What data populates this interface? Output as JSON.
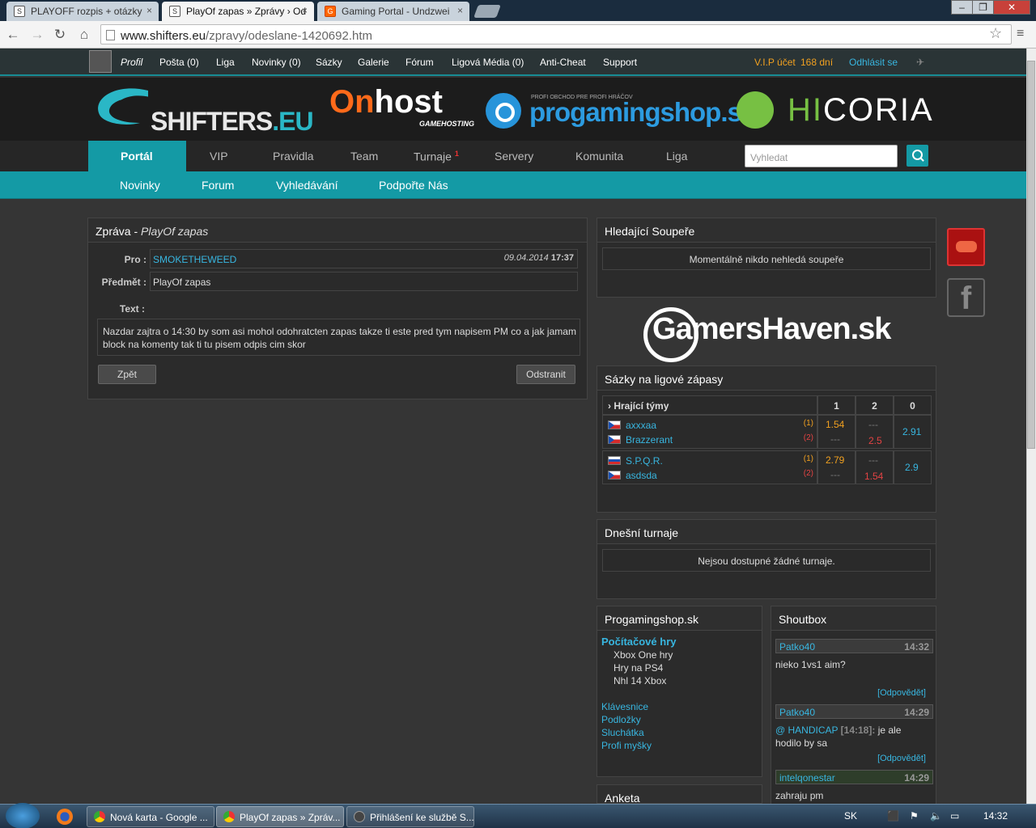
{
  "browser": {
    "tabs": [
      {
        "label": "PLAYOFF rozpis + otázky",
        "favicon": "S"
      },
      {
        "label": "PlayOf zapas » Zprávy › Od",
        "favicon": "S"
      },
      {
        "label": "Gaming Portal - Undzwei",
        "favicon": "G"
      }
    ],
    "url_host": "www.shifters.eu",
    "url_path": "/zpravy/odeslane-1420692.htm"
  },
  "topbar": {
    "profile": "Profil",
    "links": [
      "Pošta (0)",
      "Liga",
      "Novinky (0)",
      "Sázky",
      "Galerie",
      "Fórum",
      "Ligová Média (0)",
      "Anti-Cheat",
      "Support"
    ],
    "vip_label": "V.I.P účet",
    "vip_days": "168 dní",
    "logout": "Odhlásit se"
  },
  "banner": {
    "logo_main": "SHIFTERS",
    "logo_suffix": ".EU",
    "onhost_o": "On",
    "onhost_rest": "host",
    "onhost_sub": "GAMEHOSTING",
    "pgs_small": "PROFI OBCHOD PRE PROFI HRÁČOV",
    "pgs": "progamingshop.sk",
    "hic_a": "HI",
    "hic_b": "CORIA"
  },
  "mainnav": {
    "items": [
      "Portál",
      "VIP",
      "Pravidla",
      "Team",
      "Turnaje",
      "Servery",
      "Komunita",
      "Liga"
    ],
    "turnaje_badge": "1",
    "search_placeholder": "Vyhledat"
  },
  "subnav": [
    "Novinky",
    "Forum",
    "Vyhledávání",
    "Podpořte Nás"
  ],
  "message": {
    "title": "Zpráva - ",
    "title_em": "PlayOf zapas",
    "to_label": "Pro :",
    "to_value": "SMOKETHEWEED",
    "date": "09.04.2014",
    "time": "17:37",
    "subject_label": "Předmět :",
    "subject_value": "PlayOf zapas",
    "text_label": "Text :",
    "text_value": "Nazdar zajtra o 14:30 by som asi mohol odohratcten zapas takze ti este pred tym napisem PM co a jak jamam block na komenty tak ti tu pisem odpis cim skor",
    "back_btn": "Zpět",
    "delete_btn": "Odstranit"
  },
  "opponents": {
    "title": "Hledající Soupeře",
    "empty": "Momentálně nikdo nehledá soupeře"
  },
  "gamershaven": "GamersHaven.sk",
  "bets": {
    "title": "Sázky na ligové zápasy",
    "header": [
      "› Hrající týmy",
      "1",
      "2",
      "0"
    ],
    "matches": [
      {
        "team1": "axxxaa",
        "team2": "Brazzerant",
        "t1": "(1)",
        "t2": "(2)",
        "o1": "1.54",
        "o1b": "---",
        "o2a": "---",
        "o2": "2.5",
        "o0": "2.91"
      },
      {
        "team1": "S.P.Q.R.",
        "team2": "asdsda",
        "t1": "(1)",
        "t2": "(2)",
        "o1": "2.79",
        "o1b": "---",
        "o2a": "---",
        "o2": "1.54",
        "o0": "2.9"
      }
    ]
  },
  "tournaments": {
    "title": "Dnešní turnaje",
    "empty": "Nejsou dostupné žádné turnaje."
  },
  "shop": {
    "title": "Progamingshop.sk",
    "cat": "Počítačové hry",
    "sub": [
      "Xbox One hry",
      "Hry na PS4",
      "Nhl 14 Xbox"
    ],
    "links": [
      "Klávesnice",
      "Podložky",
      "Sluchátka",
      "Profi myšky"
    ]
  },
  "poll": {
    "title": "Anketa"
  },
  "shoutbox": {
    "title": "Shoutbox",
    "reply": "[Odpovědět]",
    "entries": [
      {
        "user": "Patko40",
        "time": "14:32",
        "msg": "nieko 1vs1 aim?"
      },
      {
        "user": "Patko40",
        "time": "14:29",
        "mention": "@ HANDICAP",
        "mention_time": "[14:18]:",
        "msg": "je ale",
        "msg2": "hodilo by sa"
      },
      {
        "user": "intelqonestar",
        "time": "14:29",
        "msg": "zahraju pm"
      }
    ]
  },
  "taskbar": {
    "items": [
      "Nová karta - Google ...",
      "PlayOf zapas » Zpráv...",
      "Přihlášení ke službě S..."
    ],
    "lang": "SK",
    "clock": "14:32"
  }
}
